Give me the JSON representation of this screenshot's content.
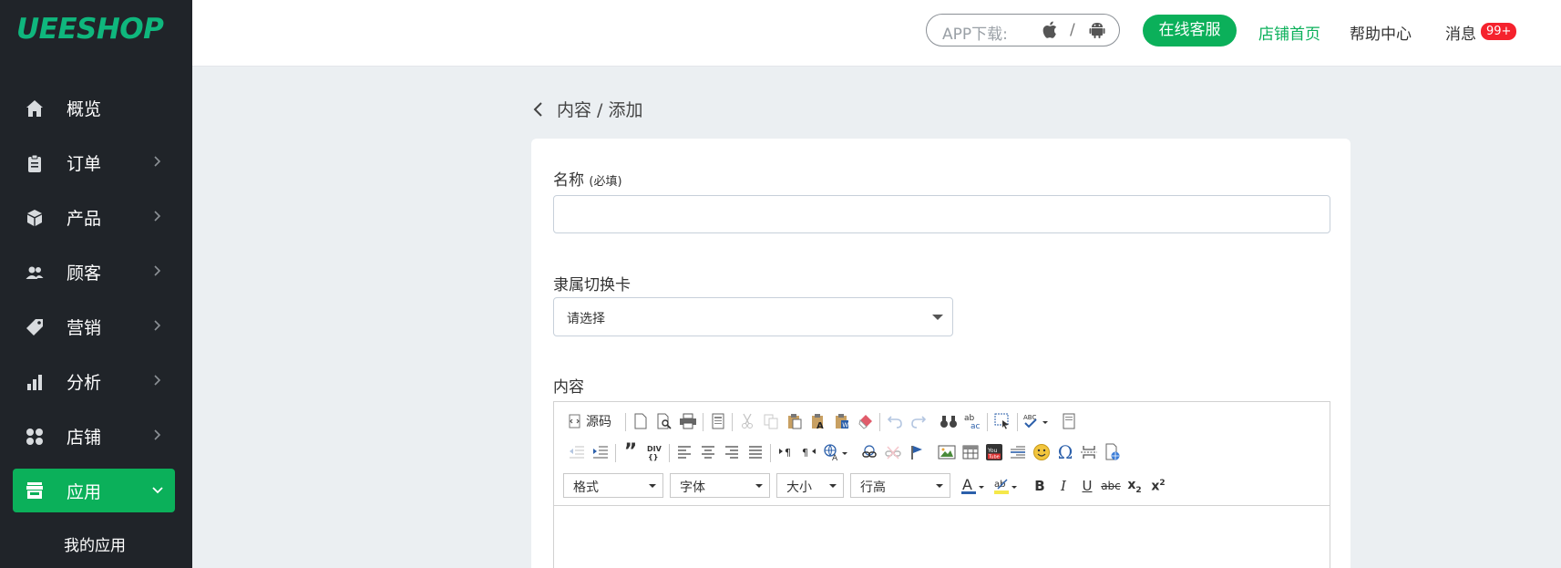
{
  "brand": {
    "logo_text": "UEESHOP",
    "color": "#0fb77d"
  },
  "sidebar": {
    "items": [
      {
        "label": "概览",
        "icon": "home-icon",
        "has_chevron": false
      },
      {
        "label": "订单",
        "icon": "clipboard-icon",
        "has_chevron": true
      },
      {
        "label": "产品",
        "icon": "cube-icon",
        "has_chevron": true
      },
      {
        "label": "顾客",
        "icon": "users-icon",
        "has_chevron": true
      },
      {
        "label": "营销",
        "icon": "tag-icon",
        "has_chevron": true
      },
      {
        "label": "分析",
        "icon": "bar-chart-icon",
        "has_chevron": true
      },
      {
        "label": "店铺",
        "icon": "grid-icon",
        "has_chevron": true
      },
      {
        "label": "应用",
        "icon": "store-icon",
        "has_chevron": true,
        "active": true
      }
    ],
    "sub_items": [
      {
        "label": "我的应用"
      }
    ]
  },
  "header": {
    "app_download_label": "APP下载:",
    "app_separator": "/",
    "service_button": "在线客服",
    "store_home": "店铺首页",
    "help_center": "帮助中心",
    "messages": "消息",
    "messages_badge": "99+"
  },
  "breadcrumb": "内容 / 添加",
  "form": {
    "name_label": "名称",
    "name_required": "(必填)",
    "name_value": "",
    "tab_label": "隶属切换卡",
    "tab_select_value": "请选择",
    "content_label": "内容"
  },
  "editor": {
    "source_label": "源码",
    "format_combo": "格式",
    "font_combo": "字体",
    "size_combo": "大小",
    "line_height_combo": "行高"
  },
  "colors": {
    "accent": "#0bb05a",
    "sidebar_bg": "#202429",
    "page_bg": "#ebeff2",
    "badge": "#f5222d"
  }
}
